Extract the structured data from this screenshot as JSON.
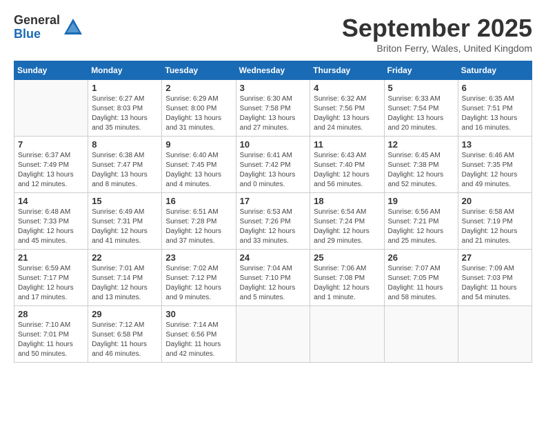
{
  "header": {
    "logo_general": "General",
    "logo_blue": "Blue",
    "month_title": "September 2025",
    "location": "Briton Ferry, Wales, United Kingdom"
  },
  "days_of_week": [
    "Sunday",
    "Monday",
    "Tuesday",
    "Wednesday",
    "Thursday",
    "Friday",
    "Saturday"
  ],
  "weeks": [
    [
      {
        "day": "",
        "info": ""
      },
      {
        "day": "1",
        "info": "Sunrise: 6:27 AM\nSunset: 8:03 PM\nDaylight: 13 hours\nand 35 minutes."
      },
      {
        "day": "2",
        "info": "Sunrise: 6:29 AM\nSunset: 8:00 PM\nDaylight: 13 hours\nand 31 minutes."
      },
      {
        "day": "3",
        "info": "Sunrise: 6:30 AM\nSunset: 7:58 PM\nDaylight: 13 hours\nand 27 minutes."
      },
      {
        "day": "4",
        "info": "Sunrise: 6:32 AM\nSunset: 7:56 PM\nDaylight: 13 hours\nand 24 minutes."
      },
      {
        "day": "5",
        "info": "Sunrise: 6:33 AM\nSunset: 7:54 PM\nDaylight: 13 hours\nand 20 minutes."
      },
      {
        "day": "6",
        "info": "Sunrise: 6:35 AM\nSunset: 7:51 PM\nDaylight: 13 hours\nand 16 minutes."
      }
    ],
    [
      {
        "day": "7",
        "info": "Sunrise: 6:37 AM\nSunset: 7:49 PM\nDaylight: 13 hours\nand 12 minutes."
      },
      {
        "day": "8",
        "info": "Sunrise: 6:38 AM\nSunset: 7:47 PM\nDaylight: 13 hours\nand 8 minutes."
      },
      {
        "day": "9",
        "info": "Sunrise: 6:40 AM\nSunset: 7:45 PM\nDaylight: 13 hours\nand 4 minutes."
      },
      {
        "day": "10",
        "info": "Sunrise: 6:41 AM\nSunset: 7:42 PM\nDaylight: 13 hours\nand 0 minutes."
      },
      {
        "day": "11",
        "info": "Sunrise: 6:43 AM\nSunset: 7:40 PM\nDaylight: 12 hours\nand 56 minutes."
      },
      {
        "day": "12",
        "info": "Sunrise: 6:45 AM\nSunset: 7:38 PM\nDaylight: 12 hours\nand 52 minutes."
      },
      {
        "day": "13",
        "info": "Sunrise: 6:46 AM\nSunset: 7:35 PM\nDaylight: 12 hours\nand 49 minutes."
      }
    ],
    [
      {
        "day": "14",
        "info": "Sunrise: 6:48 AM\nSunset: 7:33 PM\nDaylight: 12 hours\nand 45 minutes."
      },
      {
        "day": "15",
        "info": "Sunrise: 6:49 AM\nSunset: 7:31 PM\nDaylight: 12 hours\nand 41 minutes."
      },
      {
        "day": "16",
        "info": "Sunrise: 6:51 AM\nSunset: 7:28 PM\nDaylight: 12 hours\nand 37 minutes."
      },
      {
        "day": "17",
        "info": "Sunrise: 6:53 AM\nSunset: 7:26 PM\nDaylight: 12 hours\nand 33 minutes."
      },
      {
        "day": "18",
        "info": "Sunrise: 6:54 AM\nSunset: 7:24 PM\nDaylight: 12 hours\nand 29 minutes."
      },
      {
        "day": "19",
        "info": "Sunrise: 6:56 AM\nSunset: 7:21 PM\nDaylight: 12 hours\nand 25 minutes."
      },
      {
        "day": "20",
        "info": "Sunrise: 6:58 AM\nSunset: 7:19 PM\nDaylight: 12 hours\nand 21 minutes."
      }
    ],
    [
      {
        "day": "21",
        "info": "Sunrise: 6:59 AM\nSunset: 7:17 PM\nDaylight: 12 hours\nand 17 minutes."
      },
      {
        "day": "22",
        "info": "Sunrise: 7:01 AM\nSunset: 7:14 PM\nDaylight: 12 hours\nand 13 minutes."
      },
      {
        "day": "23",
        "info": "Sunrise: 7:02 AM\nSunset: 7:12 PM\nDaylight: 12 hours\nand 9 minutes."
      },
      {
        "day": "24",
        "info": "Sunrise: 7:04 AM\nSunset: 7:10 PM\nDaylight: 12 hours\nand 5 minutes."
      },
      {
        "day": "25",
        "info": "Sunrise: 7:06 AM\nSunset: 7:08 PM\nDaylight: 12 hours\nand 1 minute."
      },
      {
        "day": "26",
        "info": "Sunrise: 7:07 AM\nSunset: 7:05 PM\nDaylight: 11 hours\nand 58 minutes."
      },
      {
        "day": "27",
        "info": "Sunrise: 7:09 AM\nSunset: 7:03 PM\nDaylight: 11 hours\nand 54 minutes."
      }
    ],
    [
      {
        "day": "28",
        "info": "Sunrise: 7:10 AM\nSunset: 7:01 PM\nDaylight: 11 hours\nand 50 minutes."
      },
      {
        "day": "29",
        "info": "Sunrise: 7:12 AM\nSunset: 6:58 PM\nDaylight: 11 hours\nand 46 minutes."
      },
      {
        "day": "30",
        "info": "Sunrise: 7:14 AM\nSunset: 6:56 PM\nDaylight: 11 hours\nand 42 minutes."
      },
      {
        "day": "",
        "info": ""
      },
      {
        "day": "",
        "info": ""
      },
      {
        "day": "",
        "info": ""
      },
      {
        "day": "",
        "info": ""
      }
    ]
  ]
}
